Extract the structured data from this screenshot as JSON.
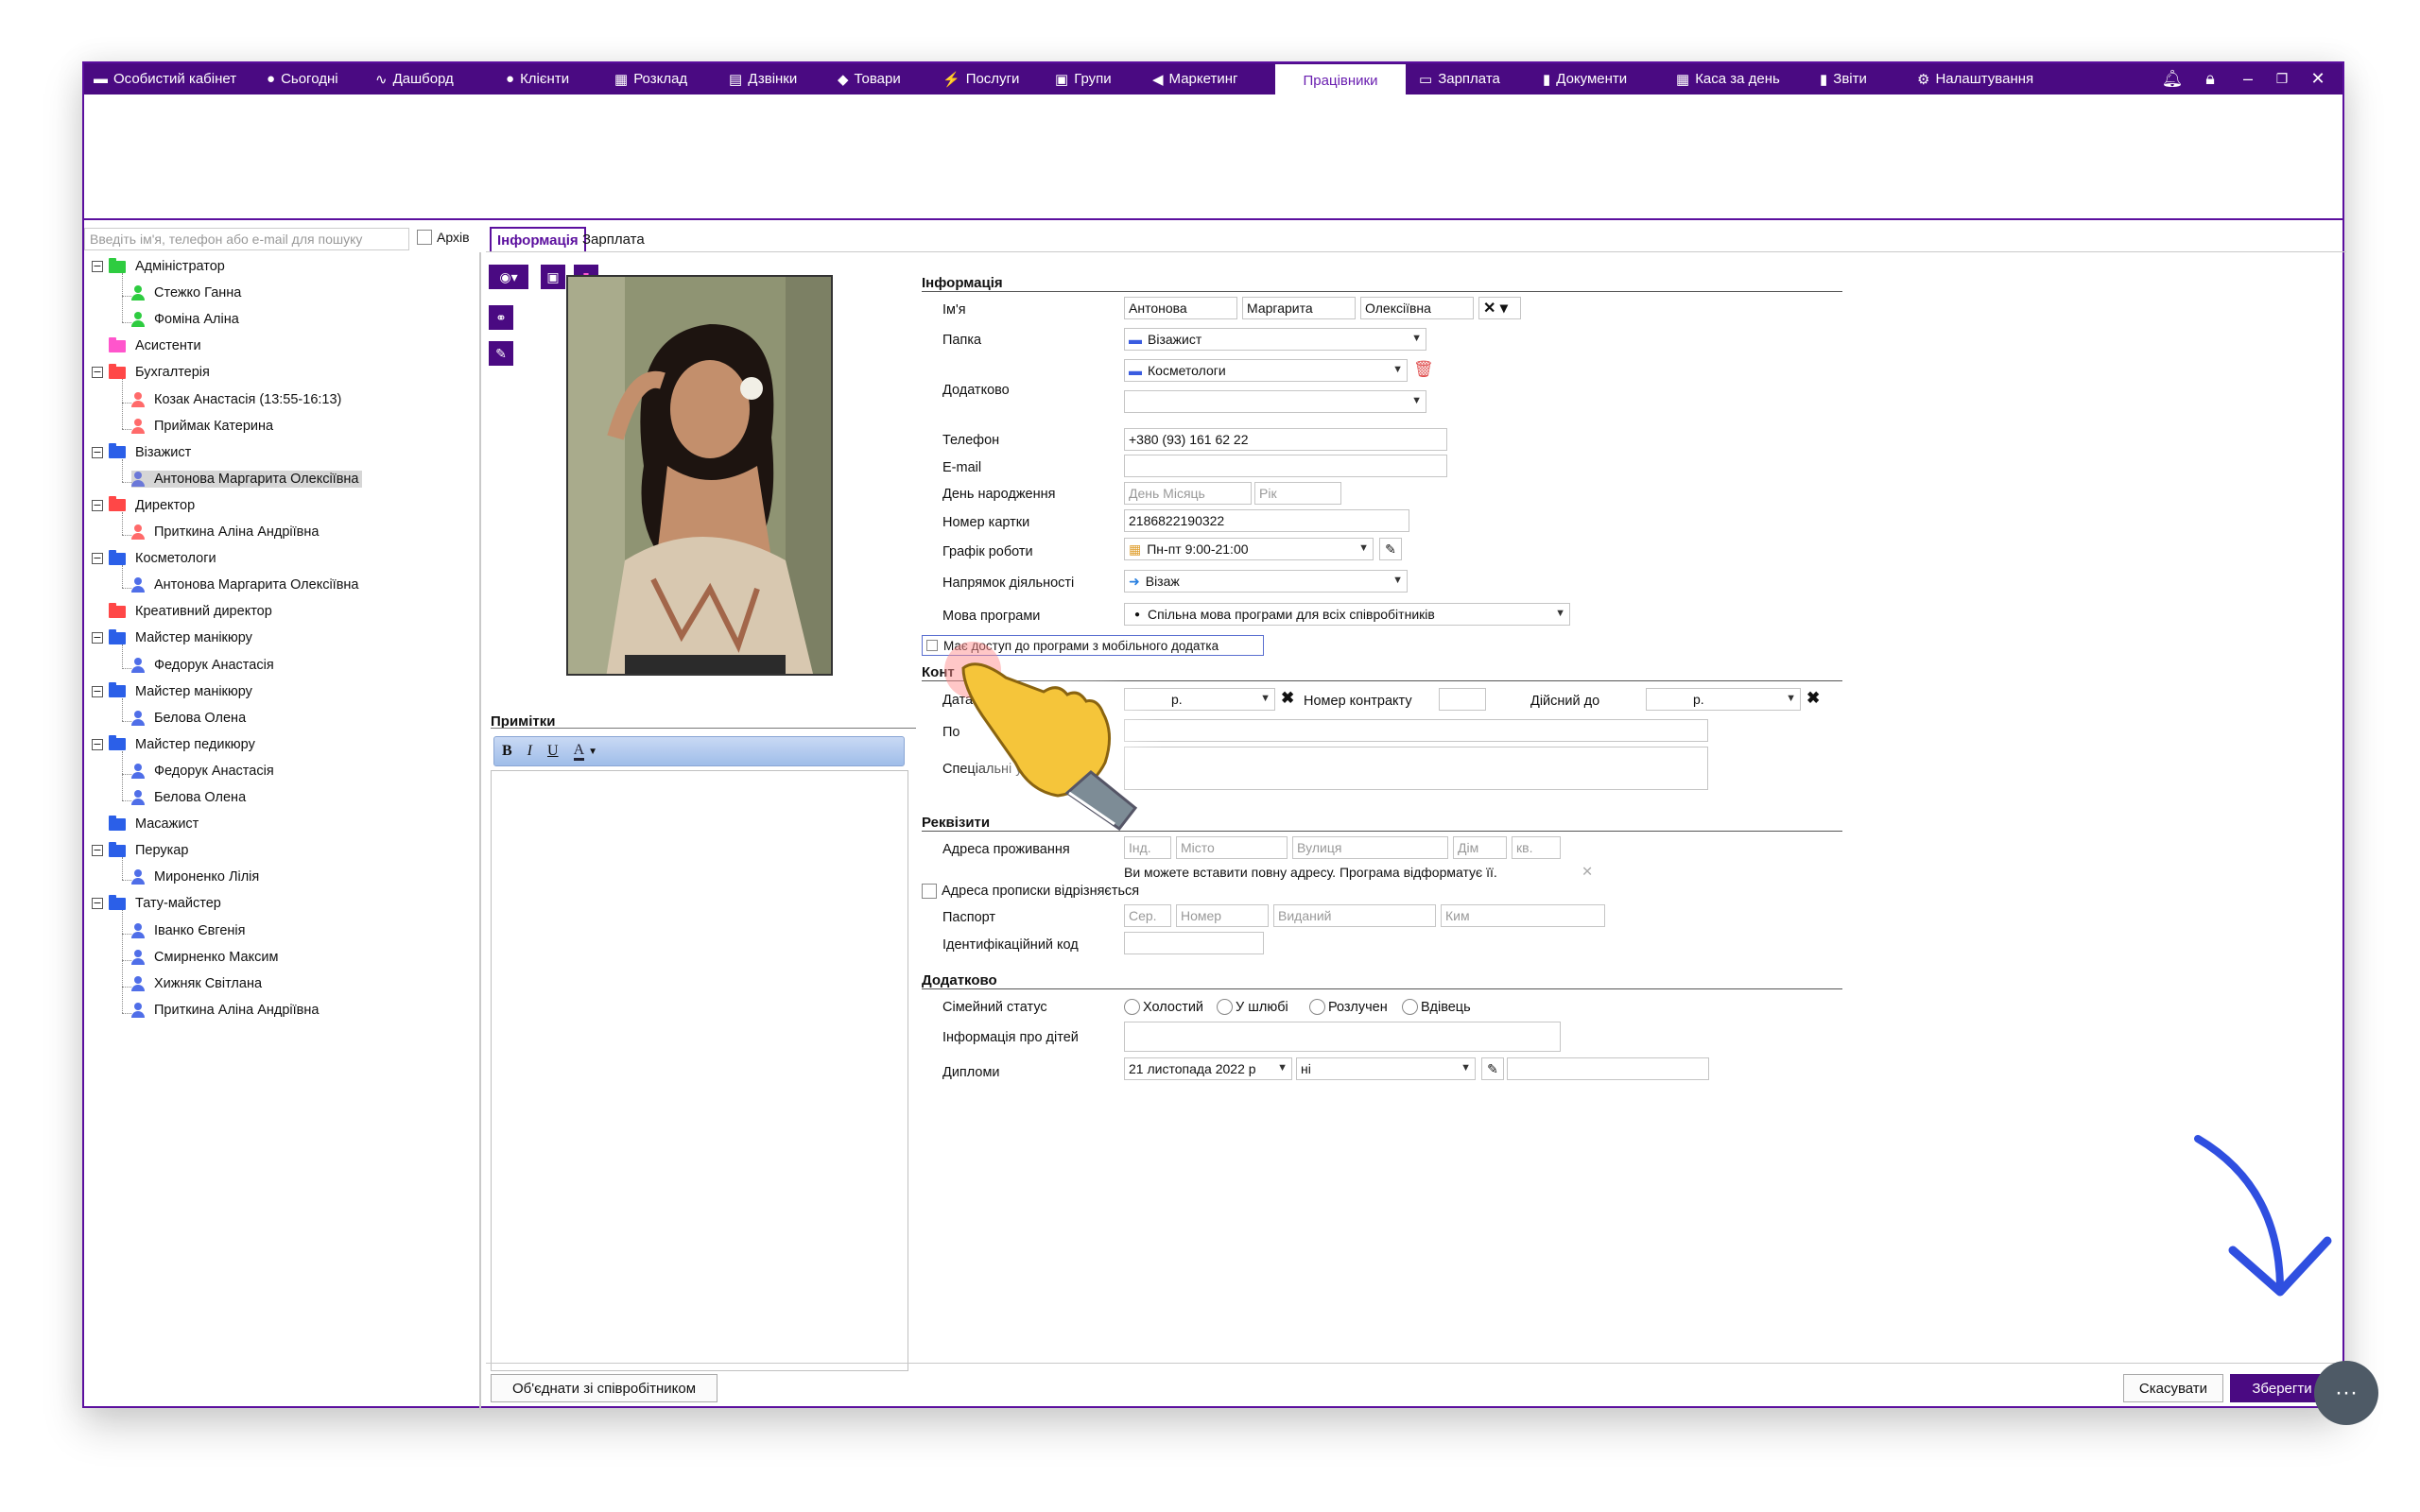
{
  "nav": [
    "Особистий кабінет",
    "Сьогодні",
    "Дашборд",
    "Клієнти",
    "Розклад",
    "Дзвінки",
    "Товари",
    "Послуги",
    "Групи",
    "Маркетинг",
    "Працівники",
    "Зарплата",
    "Документи",
    "Каса за день",
    "Звіти",
    "Налаштування"
  ],
  "search": {
    "placeholder": "Введіть ім'я, телефон або e-mail для пошуку",
    "archive": "Архів"
  },
  "tree": [
    "Адміністратор",
    "Стежко Ганна",
    "Фоміна Аліна",
    "Асистенти",
    "Бухгалтерія",
    "Козак Анастасія (13:55-16:13)",
    "Приймак Катерина",
    "Візажист",
    "Антонова Маргарита Олексіївна",
    "Директор",
    "Приткина Аліна Андріївна",
    "Косметологи",
    "Антонова Маргарита Олексіївна",
    "Креативний директор",
    "Майстер манікюру",
    "Федорук Анастасія",
    "Майстер манікюру",
    "Белова Олена",
    "Майстер педикюру",
    "Федорук Анастасія",
    "Белова Олена",
    "Масажист",
    "Перукар",
    "Мироненко Лілія",
    "Тату-майстер",
    "Іванко Євгенія",
    "Смирненко Максим",
    "Хижняк Світлана",
    "Приткина Аліна Андріївна"
  ],
  "tabs": {
    "info": "Інформація",
    "salary": "Зарплата"
  },
  "notes": {
    "title": "Примітки",
    "bold": "B",
    "italic": "I",
    "underline": "U",
    "color": "A"
  },
  "sections": {
    "info": "Інформація",
    "contract": "Конт",
    "requisites": "Реквізити",
    "extra": "Додатково"
  },
  "labels": {
    "name": "Ім'я",
    "folder": "Папка",
    "additional": "Додатково",
    "phone": "Телефон",
    "email": "E-mail",
    "birthday": "День народження",
    "card": "Номер картки",
    "schedule": "Графік роботи",
    "direction": "Напрямок діяльності",
    "lang": "Мова програми",
    "mobile": "Має доступ до програми з мобільного додатка",
    "date": "Дата",
    "pos": "По",
    "special": "Спеціальні умови",
    "contract_no": "Номер контракту",
    "valid_until": "Дійсний до",
    "address": "Адреса проживання",
    "addr_hint": "Ви можете вставити повну адресу. Програма відформатує її.",
    "reg_diff": "Адреса прописки відрізняється",
    "passport": "Паспорт",
    "idcode": "Ідентифікаційний код",
    "family": "Сімейний статус",
    "children": "Інформація про дітей",
    "diplomas": "Дипломи"
  },
  "values": {
    "last": "Антонова",
    "first": "Маргарита",
    "middle": "Олексіївна",
    "folder1": "Візажист",
    "folder2": "Косметологи",
    "phone": "+380 (93) 161 62 22",
    "card": "2186822190322",
    "schedule": "Пн-пт 9:00-21:00",
    "direction": "Візаж",
    "lang": "Спільна мова програми для всіх співробітників",
    "date_r": "р.",
    "valid_r": "р.",
    "diploma_date": "21 листопада  2022 р",
    "diploma_sel": "ні"
  },
  "placeholders": {
    "daymonth": "День Місяць",
    "year": "Рік",
    "idx": "Інд.",
    "city": "Місто",
    "street": "Вулиця",
    "house": "Дім",
    "apt": "кв.",
    "ser": "Сер.",
    "num": "Номер",
    "issued": "Виданий",
    "by": "Ким"
  },
  "family": [
    "Холостий",
    "У шлюбі",
    "Розлучен",
    "Вдівець"
  ],
  "buttons": {
    "merge": "Об'єднати зі співробітником",
    "cancel": "Скасувати",
    "save": "Зберегти"
  }
}
